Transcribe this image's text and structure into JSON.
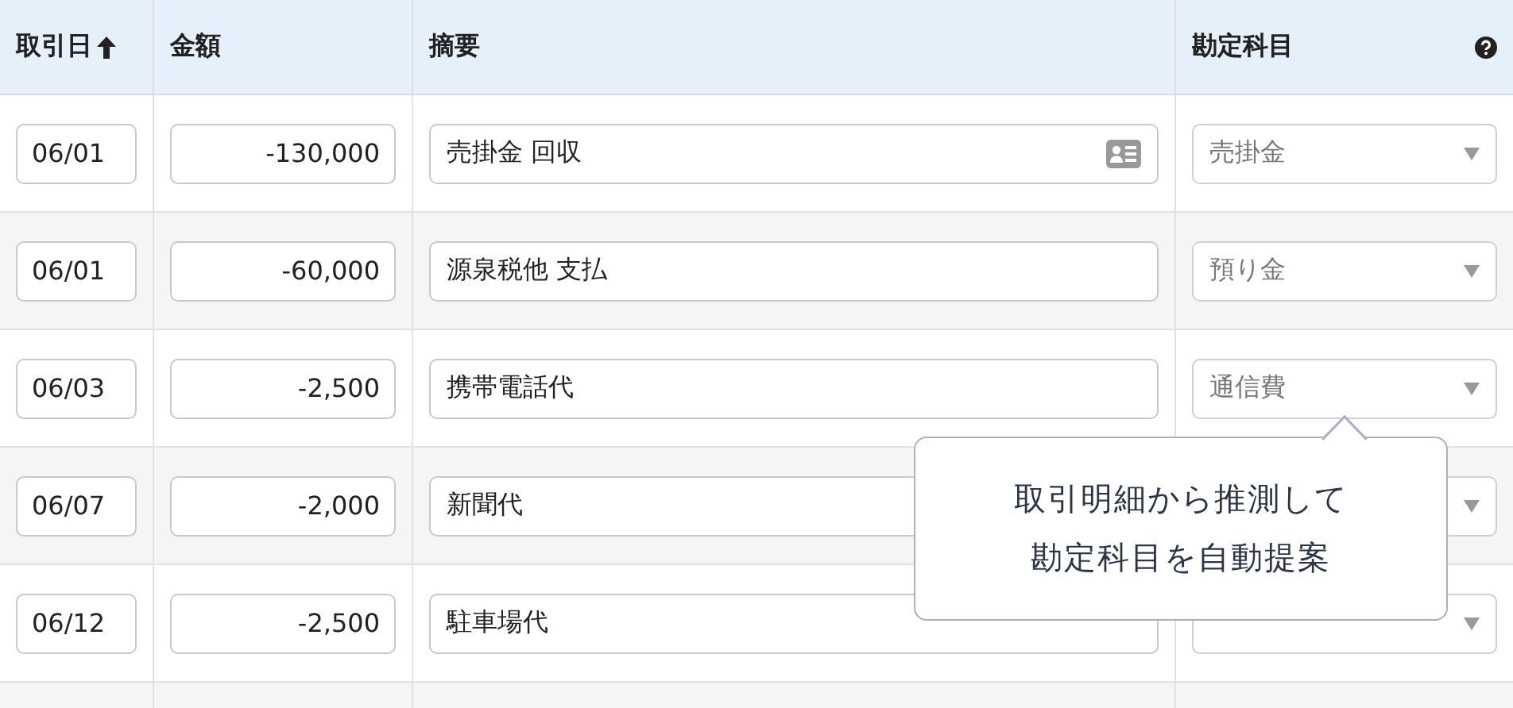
{
  "table": {
    "columns": [
      {
        "label": "取引日",
        "sorted": true
      },
      {
        "label": "金額"
      },
      {
        "label": "摘要"
      },
      {
        "label": "勘定科目",
        "help": true
      }
    ],
    "rows": [
      {
        "date": "06/01",
        "amount": "-130,000",
        "summary": "売掛金 回収",
        "contact_icon": true,
        "account": "売掛金"
      },
      {
        "date": "06/01",
        "amount": "-60,000",
        "summary": "源泉税他 支払",
        "account": "預り金"
      },
      {
        "date": "06/03",
        "amount": "-2,500",
        "summary": "携帯電話代",
        "account": "通信費"
      },
      {
        "date": "06/07",
        "amount": "-2,000",
        "summary": "新聞代"
      },
      {
        "date": "06/12",
        "amount": "-2,500",
        "summary": "駐車場代"
      }
    ]
  },
  "tooltip": {
    "lines": [
      "取引明細から推測して",
      "勘定科目を自動提案"
    ]
  }
}
